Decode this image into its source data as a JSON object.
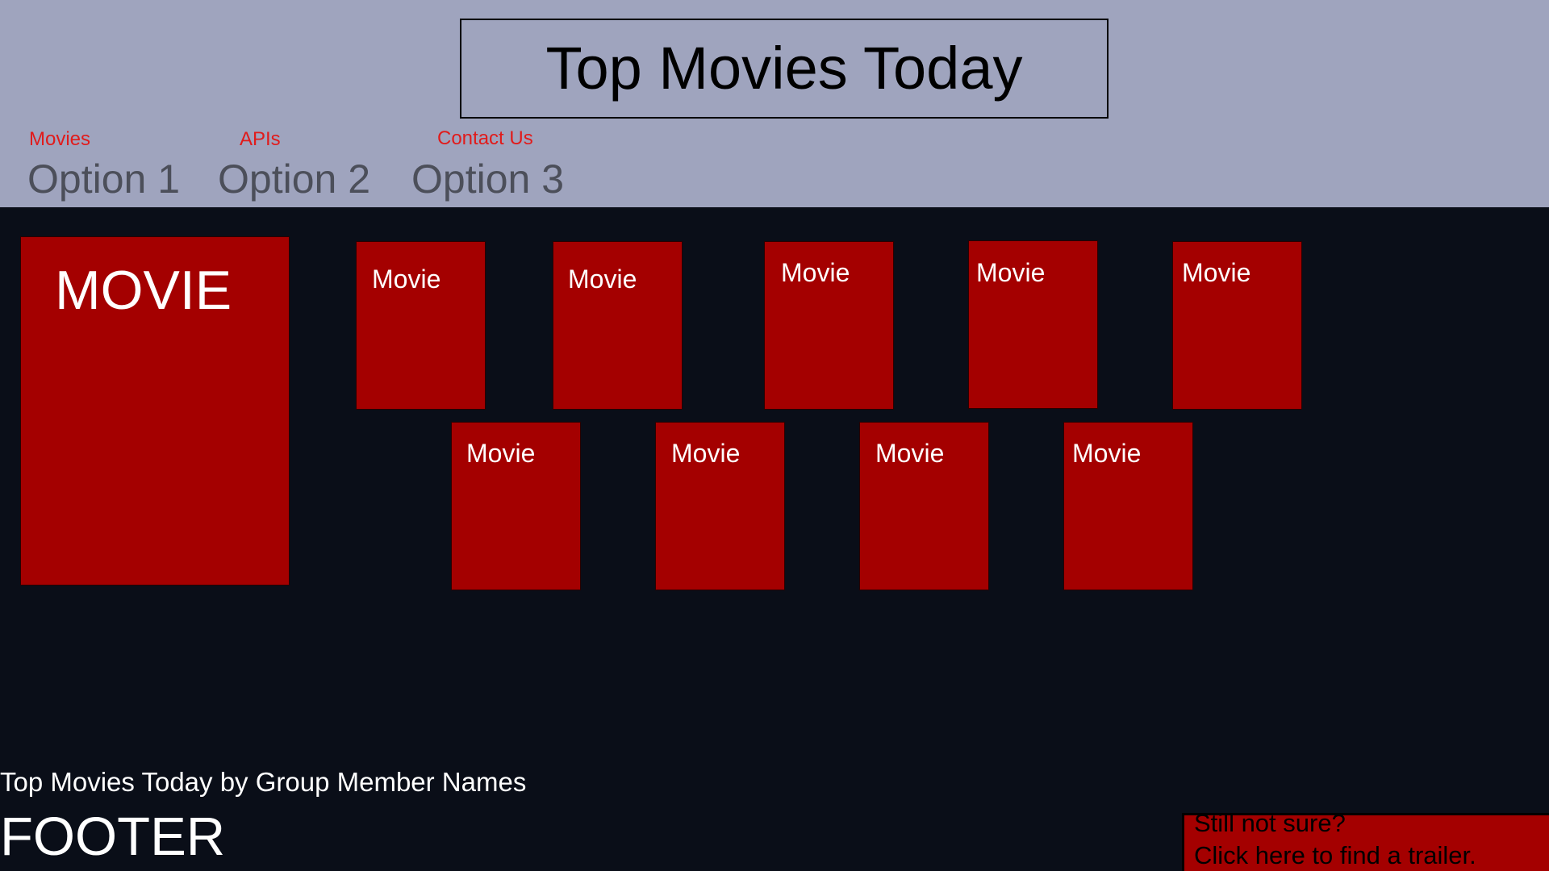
{
  "header": {
    "title": "Top Movies Today",
    "nav": [
      {
        "label": "Movies",
        "option": "Option 1"
      },
      {
        "label": "APIs",
        "option": "Option 2"
      },
      {
        "label": "Contact Us",
        "option": "Option 3"
      }
    ]
  },
  "featured": {
    "label": "MOVIE"
  },
  "movies": [
    {
      "label": "Movie"
    },
    {
      "label": "Movie"
    },
    {
      "label": "Movie"
    },
    {
      "label": "Movie"
    },
    {
      "label": "Movie"
    },
    {
      "label": "Movie"
    },
    {
      "label": "Movie"
    },
    {
      "label": "Movie"
    },
    {
      "label": "Movie"
    }
  ],
  "footer": {
    "credit": "Top Movies Today by Group Member Names",
    "label": "FOOTER",
    "trailer_prompt": {
      "line1": "Still not sure?",
      "line2": "Click here to find a trailer."
    }
  },
  "colors": {
    "header_bg": "#9fa4be",
    "page_bg": "#0a0e18",
    "card_red": "#a40000",
    "nav_label_red": "#e11b1b",
    "nav_option_gray": "#4c4f5a"
  }
}
